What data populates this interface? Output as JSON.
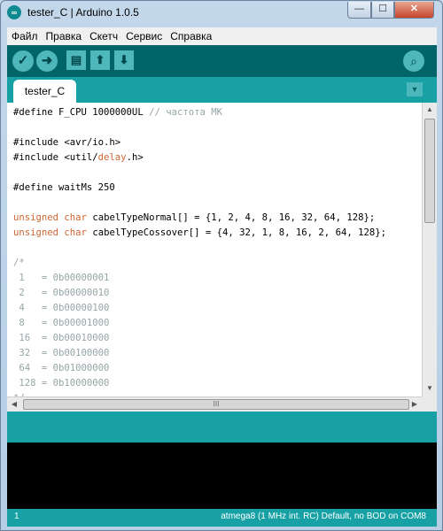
{
  "window": {
    "title": "tester_C | Arduino 1.0.5",
    "minimize": "—",
    "maximize": "☐",
    "close": "✕"
  },
  "menu": [
    "Файл",
    "Правка",
    "Скетч",
    "Сервис",
    "Справка"
  ],
  "toolbar": {
    "verify_icon": "check-icon",
    "upload_icon": "arrow-right-icon",
    "new_icon": "file-icon",
    "open_icon": "arrow-up-icon",
    "save_icon": "arrow-down-icon",
    "serial_monitor_icon": "magnifier-icon"
  },
  "tabs": {
    "active": "tester_C",
    "menu_glyph": "▼"
  },
  "editor": {
    "lines": [
      [
        {
          "t": "#define F_CPU 1000000UL "
        },
        {
          "t": "// частота МК",
          "c": "cm"
        }
      ],
      [
        {
          "t": ""
        }
      ],
      [
        {
          "t": "#include <avr/io.h>"
        }
      ],
      [
        {
          "t": "#include <util/"
        },
        {
          "t": "delay",
          "c": "kw"
        },
        {
          "t": ".h>"
        }
      ],
      [
        {
          "t": ""
        }
      ],
      [
        {
          "t": "#define waitMs 250"
        }
      ],
      [
        {
          "t": ""
        }
      ],
      [
        {
          "t": "unsigned",
          "c": "kw"
        },
        {
          "t": " "
        },
        {
          "t": "char",
          "c": "kw"
        },
        {
          "t": " cabelTypeNormal[] = {1, 2, 4, 8, 16, 32, 64, 128};"
        }
      ],
      [
        {
          "t": "unsigned",
          "c": "kw"
        },
        {
          "t": " "
        },
        {
          "t": "char",
          "c": "kw"
        },
        {
          "t": " cabelTypeCossover[] = {4, 32, 1, 8, 16, 2, 64, 128};"
        }
      ],
      [
        {
          "t": ""
        }
      ],
      [
        {
          "t": "/*",
          "c": "cm"
        }
      ],
      [
        {
          "t": " 1   = 0b00000001",
          "c": "cm"
        }
      ],
      [
        {
          "t": " 2   = 0b00000010",
          "c": "cm"
        }
      ],
      [
        {
          "t": " 4   = 0b00000100",
          "c": "cm"
        }
      ],
      [
        {
          "t": " 8   = 0b00001000",
          "c": "cm"
        }
      ],
      [
        {
          "t": " 16  = 0b00010000",
          "c": "cm"
        }
      ],
      [
        {
          "t": " 32  = 0b00100000",
          "c": "cm"
        }
      ],
      [
        {
          "t": " 64  = 0b01000000",
          "c": "cm"
        }
      ],
      [
        {
          "t": " 128 = 0b10000000",
          "c": "cm"
        }
      ],
      [
        {
          "t": "*/",
          "c": "cm"
        }
      ]
    ]
  },
  "scrollbar": {
    "up": "▲",
    "down": "▼",
    "left": "◀",
    "right": "▶",
    "grip": "III"
  },
  "status": {
    "line": "1",
    "board": "atmega8 (1 MHz int. RC) Default, no BOD on COM8"
  },
  "colors": {
    "toolbar": "#006468",
    "teal": "#17a1a5",
    "button": "#4db7bb",
    "keyword": "#cc6633",
    "comment": "#95a5a6"
  }
}
